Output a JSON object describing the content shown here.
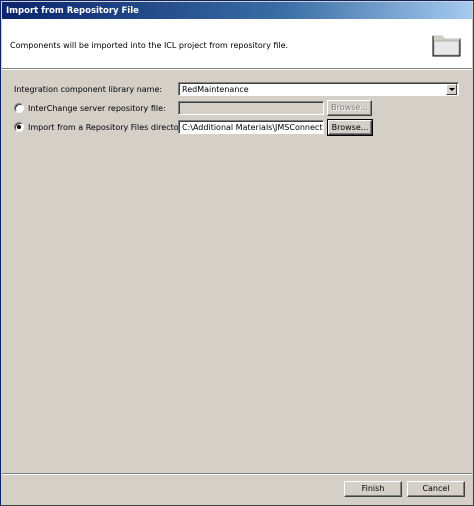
{
  "window": {
    "title": "Import from Repository File"
  },
  "banner": {
    "description": "Components will be imported into the ICL project from repository file.",
    "icon": "folder-icon"
  },
  "form": {
    "icl_name_label": "Integration component library name:",
    "icl_name_value": "RedMaintenance",
    "interchange_label": "InterChange server repository file:",
    "interchange_value": "",
    "interchange_browse_label": "Browse...",
    "repo_dir_label": "Import from a Repository Files directory",
    "repo_dir_value": "C:\\Additional Materials\\JMSConnector",
    "repo_dir_browse_label": "Browse..."
  },
  "footer": {
    "finish_label": "Finish",
    "cancel_label": "Cancel"
  }
}
